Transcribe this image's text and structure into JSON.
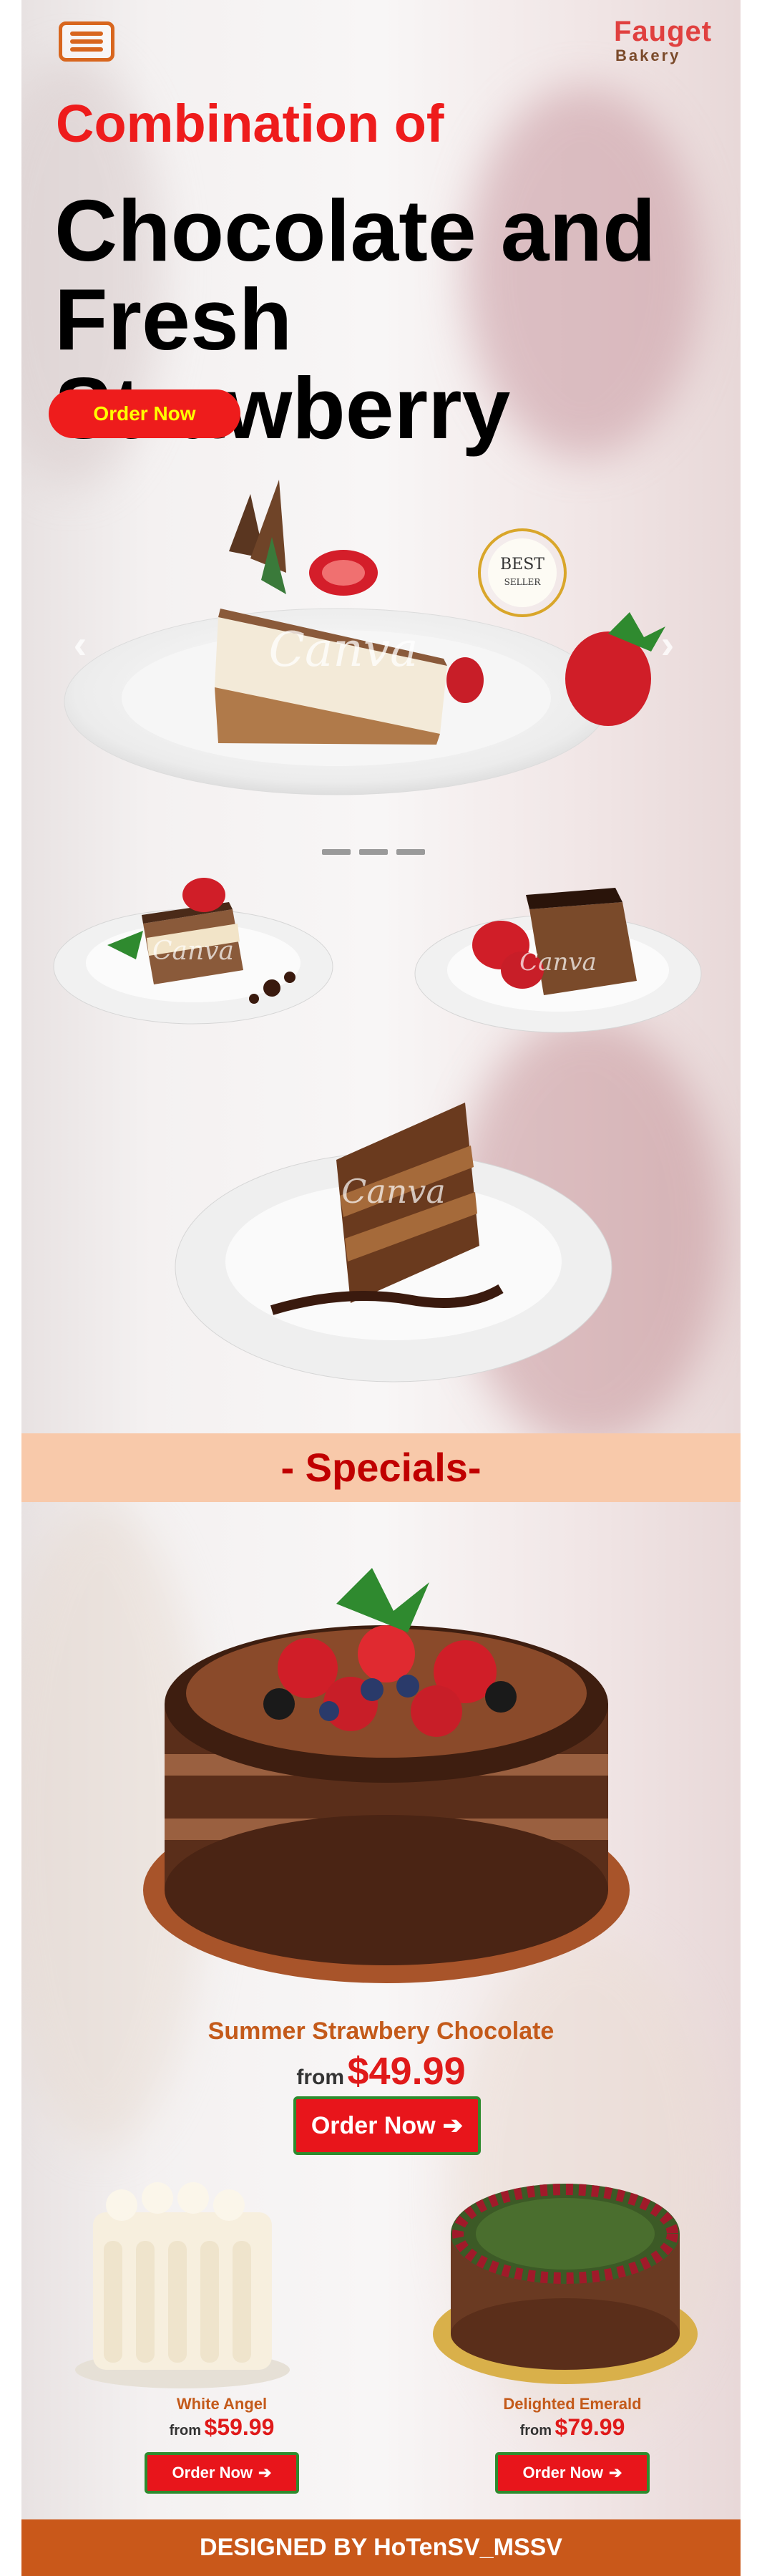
{
  "header": {
    "menu_icon": "hamburger-menu-icon",
    "brand_name": "Fauget",
    "brand_sub": "Bakery",
    "brand_color": "#e0403f"
  },
  "hero": {
    "kicker": "Combination of",
    "title": "Chocolate and Fresh Strawberry",
    "order_label": "Order Now",
    "kicker_color": "#ee1c1c",
    "button_color": "#ee1c1c",
    "button_text_color": "#ffff00"
  },
  "carousel": {
    "badge_line1": "BEST",
    "badge_line2": "SELLER",
    "watermark": "Canva",
    "prev_icon": "chevron-left-icon",
    "next_icon": "chevron-right-icon",
    "slide_count": 3
  },
  "specials": {
    "title": "- Specials-",
    "band_color": "#f8c9aa",
    "featured": {
      "name": "Summer Strawbery Chocolate",
      "from": "from",
      "price": "$49.99",
      "order_label": "Order Now"
    },
    "items": [
      {
        "name": "White Angel",
        "from": "from",
        "price": "$59.99",
        "order_label": "Order Now"
      },
      {
        "name": "Delighted Emerald",
        "from": "from",
        "price": "$79.99",
        "order_label": "Order Now"
      }
    ]
  },
  "footer": {
    "text": "DESIGNED BY HoTenSV_MSSV",
    "color": "#c9581a"
  }
}
